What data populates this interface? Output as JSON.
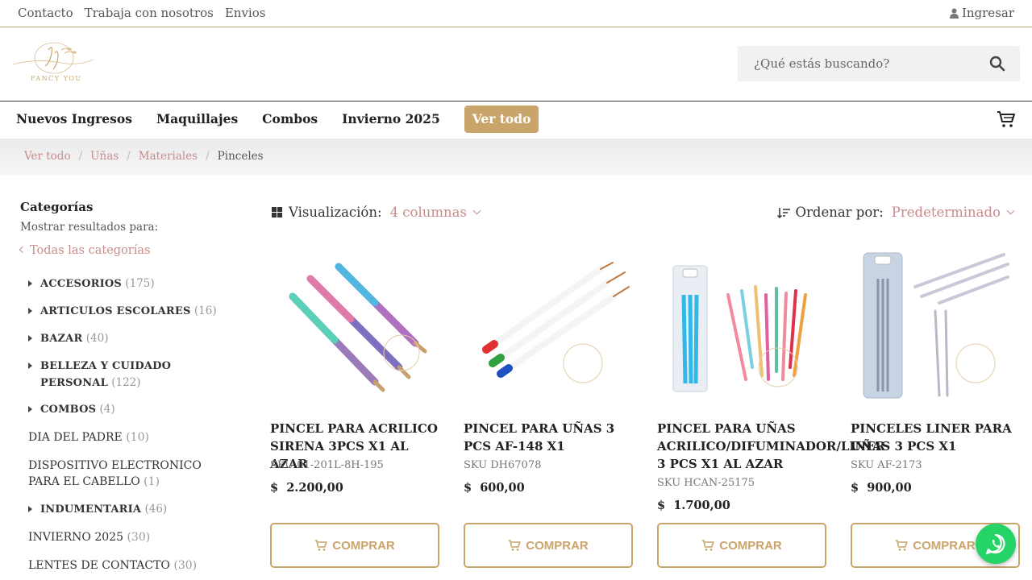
{
  "topbar": {
    "links": [
      "Contacto",
      "Trabaja con nosotros",
      "Envios"
    ],
    "login_label": "Ingresar"
  },
  "header": {
    "logo_text": "FANCY YOU",
    "search_placeholder": "¿Qué estás buscando?"
  },
  "nav": {
    "items": [
      "Nuevos Ingresos",
      "Maquillajes",
      "Combos",
      "Invierno 2025",
      "Ver todo"
    ],
    "active_index": 4
  },
  "breadcrumb": {
    "items": [
      "Ver todo",
      "Uñas",
      "Materiales"
    ],
    "current": "Pinceles"
  },
  "sidebar": {
    "title": "Categorías",
    "subtitle": "Mostrar resultados para:",
    "all_label": "Todas las categorías",
    "categories": [
      {
        "name": "ACCESORIOS",
        "count": "(175)",
        "expandable": true
      },
      {
        "name": "ARTICULOS ESCOLARES",
        "count": "(16)",
        "expandable": true
      },
      {
        "name": "BAZAR",
        "count": "(40)",
        "expandable": true
      },
      {
        "name": "BELLEZA Y CUIDADO PERSONAL",
        "count": "(122)",
        "expandable": true
      },
      {
        "name": "COMBOS",
        "count": "(4)",
        "expandable": true
      },
      {
        "name": "DIA DEL PADRE",
        "count": "(10)",
        "expandable": false
      },
      {
        "name": "DISPOSITIVO ELECTRONICO PARA EL CABELLO",
        "count": "(1)",
        "expandable": false
      },
      {
        "name": "INDUMENTARIA",
        "count": "(46)",
        "expandable": true
      },
      {
        "name": "INVIERNO 2025",
        "count": "(30)",
        "expandable": false
      },
      {
        "name": "LENTES DE CONTACTO",
        "count": "(30)",
        "expandable": false
      }
    ]
  },
  "toolbar": {
    "view_label": "Visualización:",
    "view_value": "4 columnas",
    "sort_label": "Ordenar por:",
    "sort_value": "Predeterminado"
  },
  "products": [
    {
      "name": "PINCEL PARA ACRILICO SIRENA 3PCS X1 AL AZAR",
      "sku": "SKU 01-201L-8H-195",
      "currency": "$",
      "price": "2.200,00",
      "buy_label": "COMPRAR"
    },
    {
      "name": "PINCEL PARA UÑAS 3 PCS AF-148 X1",
      "sku": "SKU DH67078",
      "currency": "$",
      "price": "600,00",
      "buy_label": "COMPRAR"
    },
    {
      "name": "PINCEL PARA UÑAS ACRILICO/DIFUMINADOR/LINER 3 PCS X1 AL AZAR",
      "sku": "SKU HCAN-25175",
      "currency": "$",
      "price": "1.700,00",
      "buy_label": "COMPRAR"
    },
    {
      "name": "PINCELES LINER PARA UÑAS 3 PCS X1",
      "sku": "SKU AF-2173",
      "currency": "$",
      "price": "900,00",
      "buy_label": "COMPRAR"
    }
  ],
  "colors": {
    "accent_gold": "#c9a56b",
    "link_rose": "#c98a8a",
    "whatsapp_green": "#25d366"
  }
}
